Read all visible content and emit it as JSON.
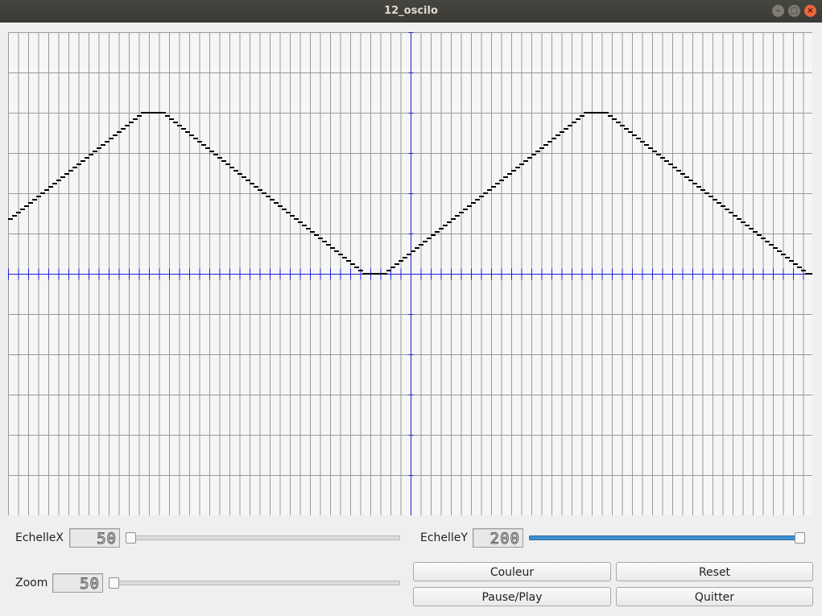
{
  "window": {
    "title": "12_oscilo"
  },
  "scope": {
    "signal": "triangle",
    "periods_visible": 2,
    "amplitude_fraction": 0.67,
    "colors": {
      "grid": "#9a9a9a",
      "axis": "#1f1fd6",
      "trace": "#000000",
      "background": "#f6f6f6"
    }
  },
  "controls": {
    "echellex_label": "EchelleX",
    "echellex_value": "50",
    "echellex_slider": 0.0,
    "echelley_label": "EchelleY",
    "echelley_value": "200",
    "echelley_slider": 1.0,
    "zoom_label": "Zoom",
    "zoom_value": "50",
    "zoom_slider": 0.0,
    "accent": "#3b8fd0"
  },
  "buttons": {
    "couleur": "Couleur",
    "reset": "Reset",
    "pause_play": "Pause/Play",
    "quitter": "Quitter"
  }
}
